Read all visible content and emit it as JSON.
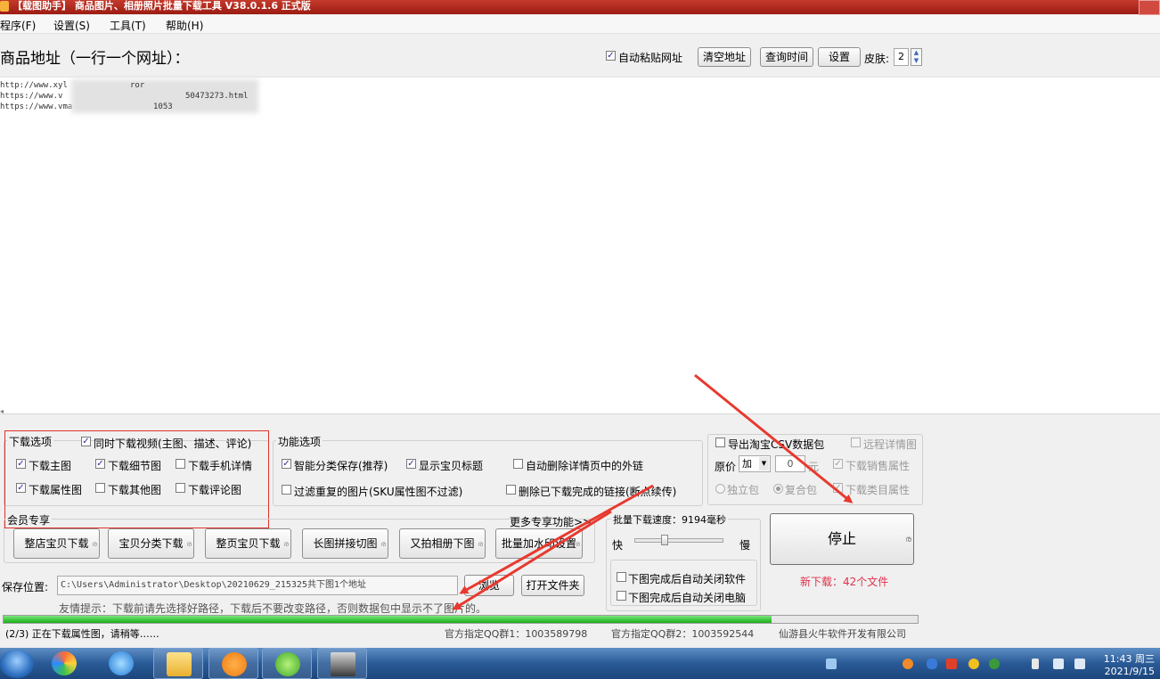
{
  "window": {
    "title": "【载图助手】 商品图片、相册照片批量下载工具 V38.0.1.6 正式版"
  },
  "menu": [
    "程序(F)",
    "设置(S)",
    "工具(T)",
    "帮助(H)"
  ],
  "header": {
    "url_label": "商品地址（一行一个网址）：",
    "auto_paste_label": "自动粘贴网址",
    "clear_button": "清空地址",
    "query_time_button": "查询时间",
    "settings_button": "设置",
    "skin_label": "皮肤:",
    "skin_value": "2"
  },
  "urls": [
    "http://www.xyl",
    "https://www.v",
    "https://www.vma"
  ],
  "url_fragments": [
    "ror",
    "50473273.html",
    "1053"
  ],
  "download_options": {
    "title": "下载选项",
    "video_label": "同时下载视频(主图、描述、评论)",
    "items": [
      {
        "label": "下载主图",
        "checked": true
      },
      {
        "label": "下载细节图",
        "checked": true
      },
      {
        "label": "下载手机详情",
        "checked": false
      },
      {
        "label": "下载属性图",
        "checked": true
      },
      {
        "label": "下载其他图",
        "checked": false
      },
      {
        "label": "下载评论图",
        "checked": false
      }
    ]
  },
  "function_options": {
    "title": "功能选项",
    "items": [
      {
        "label": "智能分类保存(推荐)",
        "checked": true
      },
      {
        "label": "显示宝贝标题",
        "checked": true
      },
      {
        "label": "自动删除详情页中的外链",
        "checked": false
      },
      {
        "label": "过滤重复的图片(SKU属性图不过滤)",
        "checked": false
      },
      {
        "label": "删除已下载完成的链接(断点续传)",
        "checked": false
      }
    ]
  },
  "export_options": {
    "export_label": "导出淘宝CSV数据包",
    "remote_detail_label": "远程详情图",
    "price_label": "原价",
    "price_op": "加",
    "price_value": "0",
    "price_unit": "元",
    "sales_attr_label": "下载销售属性",
    "standalone_label": "独立包",
    "composite_label": "复合包",
    "category_attr_label": "下载类目属性"
  },
  "member": {
    "title": "会员专享",
    "more_link": "更多专享功能>>",
    "buttons": [
      "整店宝贝下载",
      "宝贝分类下载",
      "整页宝贝下载",
      "长图拼接切图",
      "又拍相册下图",
      "批量加水印设置"
    ]
  },
  "speed": {
    "label": "批量下载速度：9194毫秒",
    "fast": "快",
    "slow": "慢",
    "level": 0.33,
    "close_app_label": "下图完成后自动关闭软件",
    "shutdown_label": "下图完成后自动关闭电脑"
  },
  "stop": {
    "button": "停止",
    "new_download": "新下载：42个文件"
  },
  "save": {
    "label": "保存位置:",
    "path": "C:\\Users\\Administrator\\Desktop\\20210629_215325共下图1个地址",
    "browse_button": "浏览",
    "open_folder_button": "打开文件夹",
    "tip": "友情提示：下载前请先选择好路径，下载后不要改变路径，否则数据包中显示不了图片的。"
  },
  "progress": {
    "fraction": 0.84
  },
  "status": {
    "message": "(2/3) 正在下载属性图，请稍等……",
    "qq_group1": "官方指定QQ群1：1003589798",
    "qq_group2": "官方指定QQ群2：1003592544",
    "company": "仙游县火牛软件开发有限公司"
  },
  "taskbar": {
    "time": "11:43 周三",
    "date": "2021/9/15"
  },
  "colors": {
    "title_bar": "#b02a1e",
    "arrow": "#e8392f",
    "accent_text": "#e0304a",
    "progress": "#22b422"
  }
}
